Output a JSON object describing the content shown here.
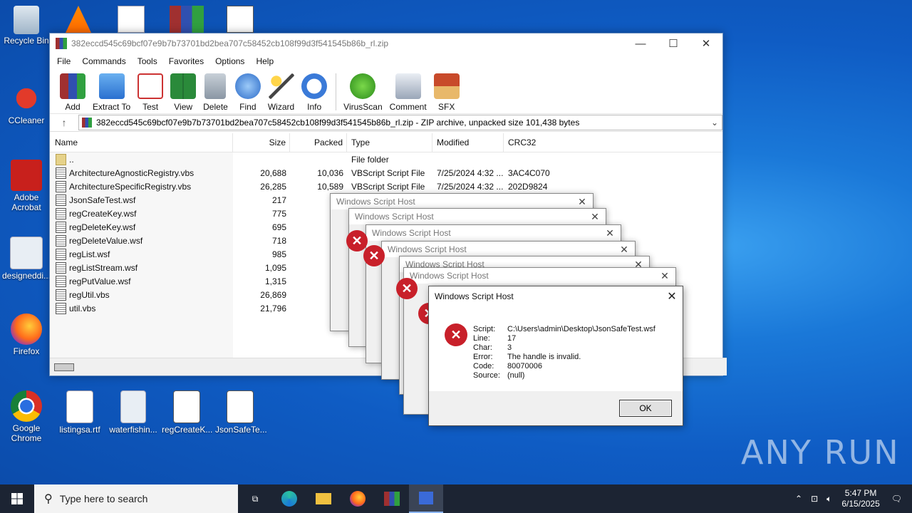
{
  "desktop": {
    "icons": [
      {
        "label": "Recycle Bin"
      },
      {
        "label": "CCleaner"
      },
      {
        "label": "Adobe Acrobat"
      },
      {
        "label": "designeddi..."
      },
      {
        "label": "Firefox"
      },
      {
        "label": "Google Chrome"
      },
      {
        "label": "listingsa.rtf"
      },
      {
        "label": "waterfishin..."
      },
      {
        "label": "regCreateK..."
      },
      {
        "label": "JsonSafeTe..."
      }
    ]
  },
  "window": {
    "title": "382eccd545c69bcf07e9b7b73701bd2bea707c58452cb108f99d3f541545b86b_rl.zip",
    "menu": [
      "File",
      "Commands",
      "Tools",
      "Favorites",
      "Options",
      "Help"
    ],
    "toolbar": [
      "Add",
      "Extract To",
      "Test",
      "View",
      "Delete",
      "Find",
      "Wizard",
      "Info",
      "VirusScan",
      "Comment",
      "SFX"
    ],
    "address": "382eccd545c69bcf07e9b7b73701bd2bea707c58452cb108f99d3f541545b86b_rl.zip - ZIP archive, unpacked size 101,438 bytes",
    "columns": {
      "name": "Name",
      "size": "Size",
      "packed": "Packed",
      "type": "Type",
      "modified": "Modified",
      "crc": "CRC32"
    },
    "files": [
      {
        "name": "..",
        "size": "",
        "packed": "",
        "type": "File folder",
        "modified": "",
        "crc": ""
      },
      {
        "name": "ArchitectureAgnosticRegistry.vbs",
        "size": "20,688",
        "packed": "10,036",
        "type": "VBScript Script File",
        "modified": "7/25/2024 4:32 ...",
        "crc": "3AC4C070"
      },
      {
        "name": "ArchitectureSpecificRegistry.vbs",
        "size": "26,285",
        "packed": "10,589",
        "type": "VBScript Script File",
        "modified": "7/25/2024 4:32 ...",
        "crc": "202D9824"
      },
      {
        "name": "JsonSafeTest.wsf",
        "size": "217",
        "packed": "",
        "type": "",
        "modified": "",
        "crc": ""
      },
      {
        "name": "regCreateKey.wsf",
        "size": "775",
        "packed": "",
        "type": "",
        "modified": "",
        "crc": ""
      },
      {
        "name": "regDeleteKey.wsf",
        "size": "695",
        "packed": "",
        "type": "",
        "modified": "",
        "crc": ""
      },
      {
        "name": "regDeleteValue.wsf",
        "size": "718",
        "packed": "",
        "type": "",
        "modified": "",
        "crc": ""
      },
      {
        "name": "regList.wsf",
        "size": "985",
        "packed": "",
        "type": "",
        "modified": "",
        "crc": ""
      },
      {
        "name": "regListStream.wsf",
        "size": "1,095",
        "packed": "",
        "type": "",
        "modified": "",
        "crc": ""
      },
      {
        "name": "regPutValue.wsf",
        "size": "1,315",
        "packed": "",
        "type": "",
        "modified": "",
        "crc": ""
      },
      {
        "name": "regUtil.vbs",
        "size": "26,869",
        "packed": "12,",
        "type": "",
        "modified": "",
        "crc": ""
      },
      {
        "name": "util.vbs",
        "size": "21,796",
        "packed": "10,",
        "type": "",
        "modified": "",
        "crc": ""
      }
    ]
  },
  "dialog": {
    "title": "Windows Script Host",
    "script_label": "Script:",
    "script": "C:\\Users\\admin\\Desktop\\JsonSafeTest.wsf",
    "line_label": "Line:",
    "line": "17",
    "char_label": "Char:",
    "char": "3",
    "error_label": "Error:",
    "error": "The handle is invalid.",
    "code_label": "Code:",
    "code": "80070006",
    "source_label": "Source:",
    "source": "(null)",
    "ok": "OK"
  },
  "taskbar": {
    "search_placeholder": "Type here to search",
    "time": "5:47 PM",
    "date": "6/15/2025"
  },
  "watermark": "ANY RUN"
}
